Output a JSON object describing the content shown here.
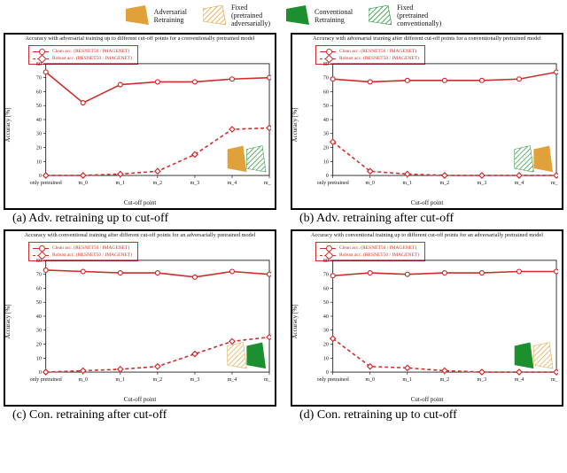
{
  "legend_top": [
    {
      "name": "adv-retrain",
      "label": "Adversarial\nRetraining",
      "color": "#e0a13a",
      "pattern": "solid"
    },
    {
      "name": "fixed-adv",
      "label": "Fixed\n(pretrained\nadversarially)",
      "color": "#e0a13a",
      "pattern": "hatched"
    },
    {
      "name": "con-retrain",
      "label": "Conventional\nRetraining",
      "color": "#1c8f2f",
      "pattern": "solid"
    },
    {
      "name": "fixed-con",
      "label": "Fixed\n(pretrained\nconventionally)",
      "color": "#1c8f2f",
      "pattern": "hatched"
    }
  ],
  "series_legend": {
    "clean": "Clean acc. (RESNET50 / IMAGENET)",
    "robust": "Robust acc. (RESNET50 / IMAGENET)"
  },
  "xlabel": "Cut-off point",
  "ylabel": "Accuracy [%]",
  "categories": [
    "only pretrained",
    "m_0",
    "m_1",
    "m_2",
    "m_3",
    "m_4",
    "m_fc"
  ],
  "captions": {
    "a": "(a) Adv. retraining up to cut-off",
    "b": "(b) Adv. retraining after cut-off",
    "c": "(c) Con. retraining after cut-off",
    "d": "(d) Con. retraining up to cut-off"
  },
  "chart_data": [
    {
      "id": "a",
      "type": "line",
      "title": "Accuracy with adversarial training up to different cut-off points for a conventionally pretrained model",
      "xlabel": "Cut-off point",
      "ylabel": "Accuracy [%]",
      "ylim": [
        0,
        80
      ],
      "categories": [
        "only pretrained",
        "m_0",
        "m_1",
        "m_2",
        "m_3",
        "m_4",
        "m_fc"
      ],
      "series": [
        {
          "name": "Clean acc. (RESNET50 / IMAGENET)",
          "style": "solid",
          "marker": "circle",
          "values": [
            74,
            52,
            65,
            67,
            67,
            69,
            70
          ]
        },
        {
          "name": "Robust acc. (RESNET50 / IMAGENET)",
          "style": "dashed",
          "marker": "diamond",
          "values": [
            0,
            0,
            1,
            3,
            15,
            33,
            34
          ]
        }
      ],
      "inset_icons": [
        {
          "color": "#e0a13a",
          "pattern": "solid"
        },
        {
          "color": "#1c8f2f",
          "pattern": "hatched"
        }
      ]
    },
    {
      "id": "b",
      "type": "line",
      "title": "Accuracy with adversarial training after different cut-off points for a conventionally pretrained model",
      "xlabel": "Cut-off point",
      "ylabel": "Accuracy [%]",
      "ylim": [
        0,
        80
      ],
      "categories": [
        "only pretrained",
        "m_0",
        "m_1",
        "m_2",
        "m_3",
        "m_4",
        "m_fc"
      ],
      "series": [
        {
          "name": "Clean acc. (RESNET50 / IMAGENET)",
          "style": "solid",
          "marker": "circle",
          "values": [
            69,
            67,
            68,
            68,
            68,
            69,
            74
          ]
        },
        {
          "name": "Robust acc. (RESNET50 / IMAGENET)",
          "style": "dashed",
          "marker": "diamond",
          "values": [
            24,
            3,
            1,
            0,
            0,
            0,
            0
          ]
        }
      ],
      "inset_icons": [
        {
          "color": "#1c8f2f",
          "pattern": "hatched"
        },
        {
          "color": "#e0a13a",
          "pattern": "solid"
        }
      ]
    },
    {
      "id": "c",
      "type": "line",
      "title": "Accuracy with conventional training after different cut-off points for an adversarially pretrained model",
      "xlabel": "Cut-off point",
      "ylabel": "Accuracy [%]",
      "ylim": [
        0,
        80
      ],
      "categories": [
        "only pretrained",
        "m_0",
        "m_1",
        "m_2",
        "m_3",
        "m_4",
        "m_fc"
      ],
      "series": [
        {
          "name": "Clean acc. (RESNET50 / IMAGENET)",
          "style": "solid",
          "marker": "circle",
          "values": [
            73,
            72,
            71,
            71,
            68,
            72,
            70
          ]
        },
        {
          "name": "Robust acc. (RESNET50 / IMAGENET)",
          "style": "dashed",
          "marker": "diamond",
          "values": [
            0,
            1,
            2,
            4,
            13,
            22,
            25
          ]
        }
      ],
      "inset_icons": [
        {
          "color": "#e0a13a",
          "pattern": "hatched"
        },
        {
          "color": "#1c8f2f",
          "pattern": "solid"
        }
      ]
    },
    {
      "id": "d",
      "type": "line",
      "title": "Accuracy with conventional training up to different cut-off points for an adversarially pretrained model",
      "xlabel": "Cut-off point",
      "ylabel": "Accuracy [%]",
      "ylim": [
        0,
        80
      ],
      "categories": [
        "only pretrained",
        "m_0",
        "m_1",
        "m_2",
        "m_3",
        "m_4",
        "m_fc"
      ],
      "series": [
        {
          "name": "Clean acc. (RESNET50 / IMAGENET)",
          "style": "solid",
          "marker": "circle",
          "values": [
            69,
            71,
            70,
            71,
            71,
            72,
            72
          ]
        },
        {
          "name": "Robust acc. (RESNET50 / IMAGENET)",
          "style": "dashed",
          "marker": "diamond",
          "values": [
            24,
            4,
            3,
            1,
            0,
            0,
            0
          ]
        }
      ],
      "inset_icons": [
        {
          "color": "#1c8f2f",
          "pattern": "solid"
        },
        {
          "color": "#e0a13a",
          "pattern": "hatched"
        }
      ]
    }
  ]
}
